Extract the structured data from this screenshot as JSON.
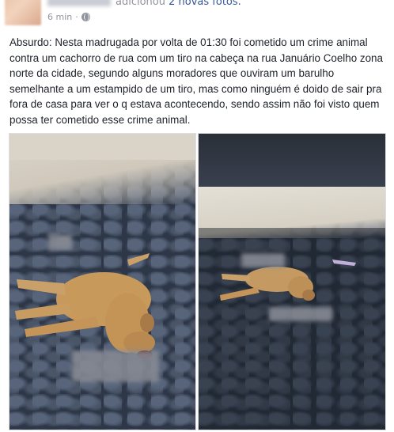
{
  "header": {
    "action_text": "adicionou",
    "action_link": "2 novas fotos.",
    "timestamp": "6 min",
    "separator": "·",
    "privacy_icon": "globe-icon"
  },
  "post": {
    "text": "Absurdo: Nesta madrugada por volta de 01:30 foi cometido um crime animal contra um cachorro de rua com um tiro na cabeça na rua Januário Coelho zona norte da cidade, segundo alguns moradores que ouviram um barulho semelhante a um estampido de um tiro, mas como ninguém é doido de sair pra fora de casa para ver o q estava acontecendo, sendo assim não foi visto quem possa ter cometido esse crime animal."
  },
  "colors": {
    "link": "#365899",
    "meta_gray": "#90949c",
    "text": "#1d2129"
  }
}
